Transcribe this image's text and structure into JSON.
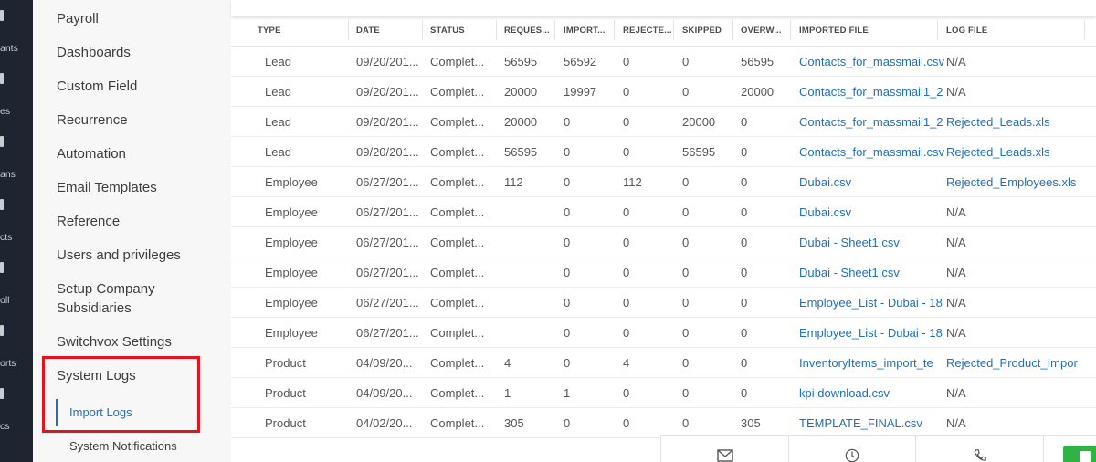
{
  "rail": {
    "items": [
      {
        "label": "ants"
      },
      {
        "label": "es"
      },
      {
        "label": "ans"
      },
      {
        "label": "cts"
      },
      {
        "label": "oll"
      },
      {
        "label": "orts"
      },
      {
        "label": "cs"
      }
    ]
  },
  "sidebar": {
    "items": [
      {
        "label": "Payroll"
      },
      {
        "label": "Dashboards"
      },
      {
        "label": "Custom Field"
      },
      {
        "label": "Recurrence"
      },
      {
        "label": "Automation"
      },
      {
        "label": "Email Templates"
      },
      {
        "label": "Reference"
      },
      {
        "label": "Users and privileges"
      },
      {
        "label": "Setup Company Subsidiaries"
      },
      {
        "label": "Switchvox Settings"
      },
      {
        "label": "System Logs"
      }
    ],
    "sub_items": [
      {
        "label": "Import Logs",
        "active": true
      },
      {
        "label": "System Notifications",
        "active": false
      }
    ]
  },
  "table": {
    "headers": [
      "TYPE",
      "DATE",
      "STATUS",
      "REQUES...",
      "IMPORT...",
      "REJECTE...",
      "SKIPPED",
      "OVERW...",
      "IMPORTED FILE",
      "LOG FILE"
    ],
    "rows": [
      [
        "Lead",
        "09/20/201...",
        "Complet...",
        "56595",
        "56592",
        "0",
        "0",
        "56595",
        "Contacts_for_massmail.csv",
        "N/A"
      ],
      [
        "Lead",
        "09/20/201...",
        "Complet...",
        "20000",
        "19997",
        "0",
        "0",
        "20000",
        "Contacts_for_massmail1_2",
        "N/A"
      ],
      [
        "Lead",
        "09/20/201...",
        "Complet...",
        "20000",
        "0",
        "0",
        "20000",
        "0",
        "Contacts_for_massmail1_2",
        "Rejected_Leads.xls"
      ],
      [
        "Lead",
        "09/20/201...",
        "Complet...",
        "56595",
        "0",
        "0",
        "56595",
        "0",
        "Contacts_for_massmail.csv",
        "Rejected_Leads.xls"
      ],
      [
        "Employee",
        "06/27/201...",
        "Complet...",
        "112",
        "0",
        "112",
        "0",
        "0",
        "Dubai.csv",
        "Rejected_Employees.xls"
      ],
      [
        "Employee",
        "06/27/201...",
        "Complet...",
        "",
        "0",
        "0",
        "0",
        "0",
        "Dubai.csv",
        "N/A"
      ],
      [
        "Employee",
        "06/27/201...",
        "Complet...",
        "",
        "0",
        "0",
        "0",
        "0",
        "Dubai - Sheet1.csv",
        "N/A"
      ],
      [
        "Employee",
        "06/27/201...",
        "Complet...",
        "",
        "0",
        "0",
        "0",
        "0",
        "Dubai - Sheet1.csv",
        "N/A"
      ],
      [
        "Employee",
        "06/27/201...",
        "Complet...",
        "",
        "0",
        "0",
        "0",
        "0",
        "Employee_List - Dubai - 18",
        "N/A"
      ],
      [
        "Employee",
        "06/27/201...",
        "Complet...",
        "",
        "0",
        "0",
        "0",
        "0",
        "Employee_List - Dubai - 18",
        "N/A"
      ],
      [
        "Product",
        "04/09/20...",
        "Complet...",
        "4",
        "0",
        "4",
        "0",
        "0",
        "InventoryItems_import_te",
        "Rejected_Product_Impor"
      ],
      [
        "Product",
        "04/09/20...",
        "Complet...",
        "1",
        "1",
        "0",
        "0",
        "0",
        "kpi download.csv",
        "N/A"
      ],
      [
        "Product",
        "04/02/20...",
        "Complet...",
        "305",
        "0",
        "0",
        "0",
        "305",
        "TEMPLATE_FINAL.csv",
        "N/A"
      ]
    ]
  },
  "bottom_bar": {
    "icons": [
      "mail-icon",
      "clock-icon",
      "phone-icon"
    ]
  },
  "colors": {
    "rail_bg": "#1e2531",
    "sidebar_bg": "#f7f7f7",
    "link": "#1d6fbf",
    "highlight": "#e8121c",
    "green_button": "#2fb344"
  }
}
